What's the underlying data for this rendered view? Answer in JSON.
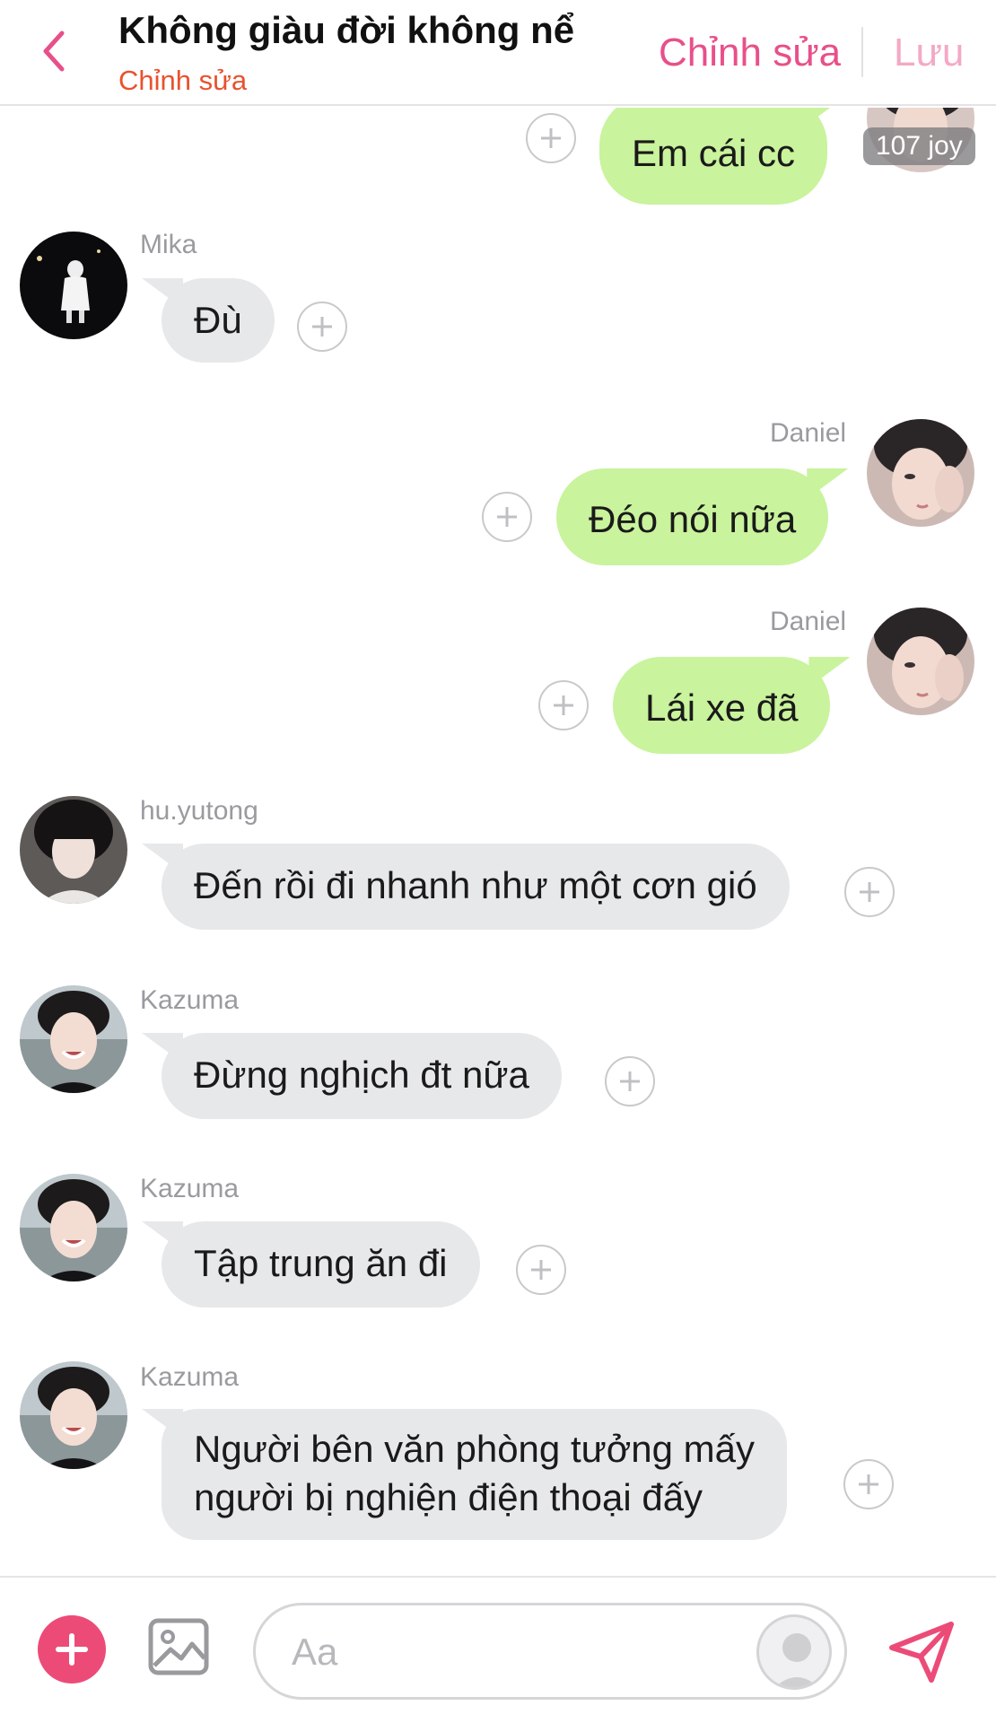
{
  "header": {
    "title": "Không giàu đời không nể",
    "subtitle": "Chỉnh sửa",
    "edit_label": "Chỉnh sửa",
    "save_label": "Lưu"
  },
  "top_message": {
    "text": "Em cái cc",
    "badge": "107 joy"
  },
  "messages": [
    {
      "sender": "Mika",
      "text": "Đù",
      "side": "left"
    },
    {
      "sender": "Daniel",
      "text": "Đéo nói nữa",
      "side": "right"
    },
    {
      "sender": "Daniel",
      "text": "Lái xe đã",
      "side": "right"
    },
    {
      "sender": "hu.yutong",
      "text": "Đến rồi đi nhanh như một cơn gió",
      "side": "left"
    },
    {
      "sender": "Kazuma",
      "text": "Đừng nghịch đt nữa",
      "side": "left"
    },
    {
      "sender": "Kazuma",
      "text": "Tập trung ăn đi",
      "side": "left"
    },
    {
      "sender": "Kazuma",
      "text": "Người bên văn phòng tưởng mấy người bị nghiện điện thoại đấy",
      "text_lines": [
        "Người bên văn phòng tưởng mấy",
        "người bị nghiện điện thoại đấy"
      ],
      "side": "left"
    }
  ],
  "composer": {
    "placeholder": "Aa"
  },
  "colors": {
    "accent": "#ec4b78",
    "outgoing_bubble": "#c9f39c",
    "incoming_bubble": "#e7e8ea",
    "subtitle": "#e8522e"
  },
  "icons": [
    "chevron-left-icon",
    "plus-icon",
    "image-icon",
    "user-silhouette-icon",
    "send-icon"
  ]
}
